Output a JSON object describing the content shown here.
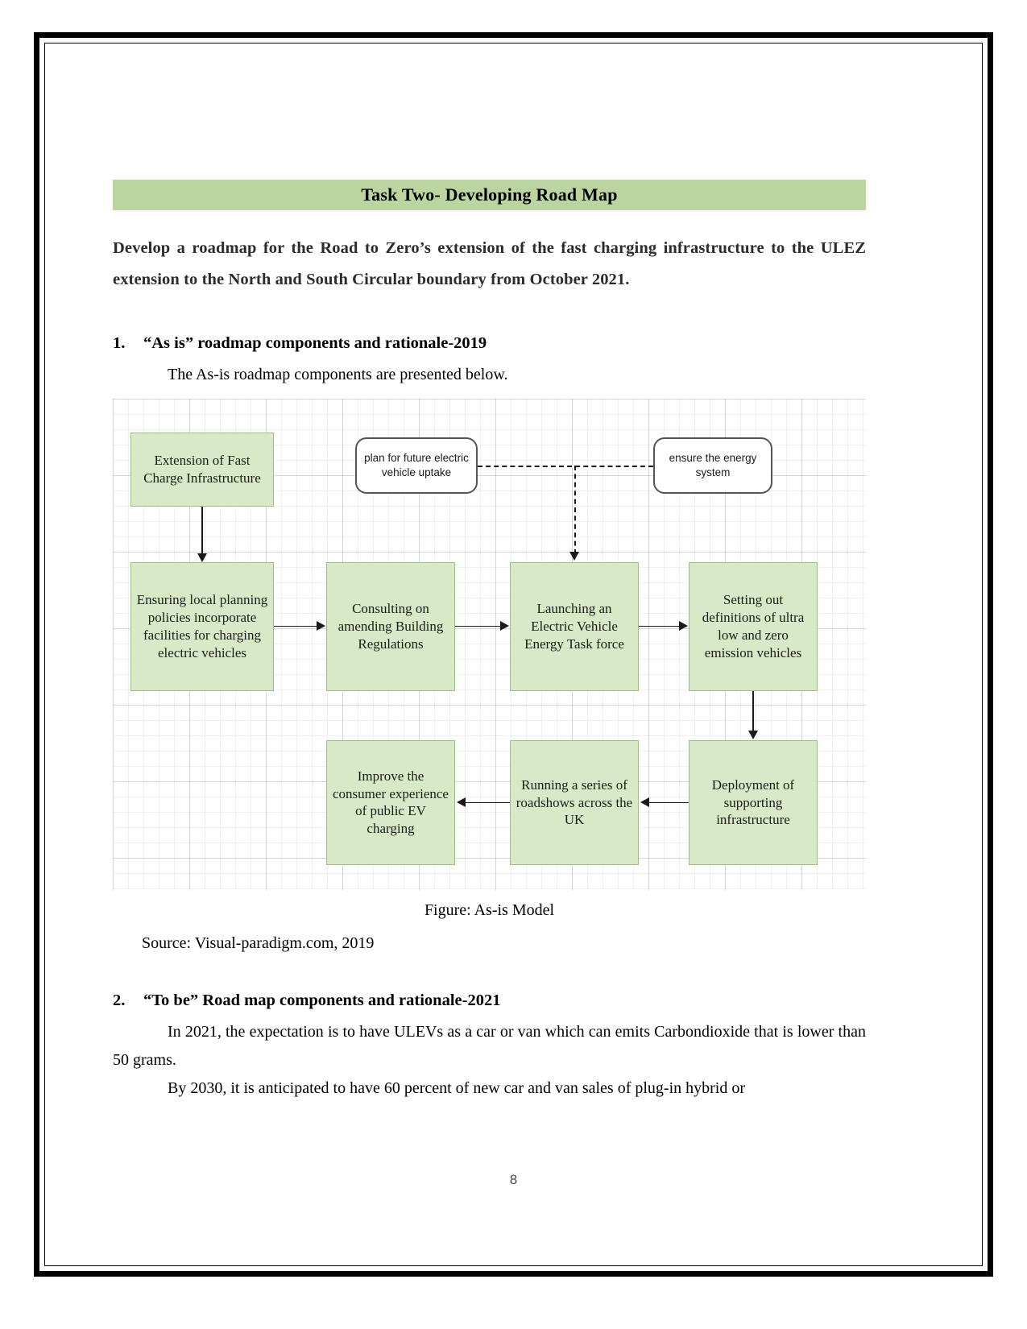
{
  "document": {
    "page_number": "8",
    "accent_color": "#bbd5a0",
    "node_fill_color": "#d7e9c6",
    "node_border_color": "#9dbf86"
  },
  "title_banner": {
    "text": "Task Two- Developing Road Map"
  },
  "intro": {
    "text": "Develop a roadmap for the Road to Zero’s extension of the fast charging infrastructure to the ULEZ extension to the North and South Circular boundary from October 2021."
  },
  "section_one": {
    "number": "1.",
    "heading": "“As is” roadmap components and rationale-2019",
    "lead_paragraph": "The As-is roadmap components are presented below.",
    "figure_caption": "Figure: As-is Model",
    "source": "Source: Visual-paradigm.com, 2019"
  },
  "section_two": {
    "number": "2.",
    "heading": "“To be” Road map components and rationale-2021",
    "paragraph_one": "In 2021, the expectation is to have ULEVs as a car or van which can emits Carbondioxide that is lower than 50 grams.",
    "paragraph_two": "By 2030, it is anticipated to have 60 percent of new car and van sales of plug-in hybrid or"
  },
  "diagram": {
    "type": "flowchart",
    "nodes": [
      {
        "id": "extension",
        "label": "Extension of Fast Charge Infrastructure",
        "shape": "rect",
        "style": "green"
      },
      {
        "id": "plan-uptake",
        "label": "plan for future electric vehicle uptake",
        "shape": "rounded-rect",
        "style": "white"
      },
      {
        "id": "energy-system",
        "label": "ensure the energy system",
        "shape": "rounded-rect",
        "style": "white"
      },
      {
        "id": "local-plan",
        "label": "Ensuring local planning policies incorporate facilities for charging electric vehicles",
        "shape": "rect",
        "style": "green"
      },
      {
        "id": "consulting",
        "label": "Consulting on amending Building Regulations",
        "shape": "rect",
        "style": "green"
      },
      {
        "id": "taskforce",
        "label": "Launching an Electric Vehicle Energy Task force",
        "shape": "rect",
        "style": "green"
      },
      {
        "id": "definitions",
        "label": "Setting out definitions of ultra low and zero emission vehicles",
        "shape": "rect",
        "style": "green"
      },
      {
        "id": "deployment",
        "label": "Deployment of supporting infrastructure",
        "shape": "rect",
        "style": "green"
      },
      {
        "id": "roadshows",
        "label": "Running a series of roadshows across the UK",
        "shape": "rect",
        "style": "green"
      },
      {
        "id": "consumer-exp",
        "label": "Improve the consumer experience of public EV charging",
        "shape": "rect",
        "style": "green"
      }
    ],
    "edges": [
      {
        "from": "extension",
        "to": "local-plan",
        "style": "solid"
      },
      {
        "from": "local-plan",
        "to": "consulting",
        "style": "solid"
      },
      {
        "from": "consulting",
        "to": "taskforce",
        "style": "solid"
      },
      {
        "from": "taskforce",
        "to": "definitions",
        "style": "solid"
      },
      {
        "from": "definitions",
        "to": "deployment",
        "style": "solid"
      },
      {
        "from": "deployment",
        "to": "roadshows",
        "style": "solid"
      },
      {
        "from": "roadshows",
        "to": "consumer-exp",
        "style": "solid"
      },
      {
        "from": "plan-uptake",
        "to": "taskforce",
        "style": "dashed"
      },
      {
        "from": "energy-system",
        "to": "taskforce",
        "style": "dashed"
      }
    ]
  }
}
